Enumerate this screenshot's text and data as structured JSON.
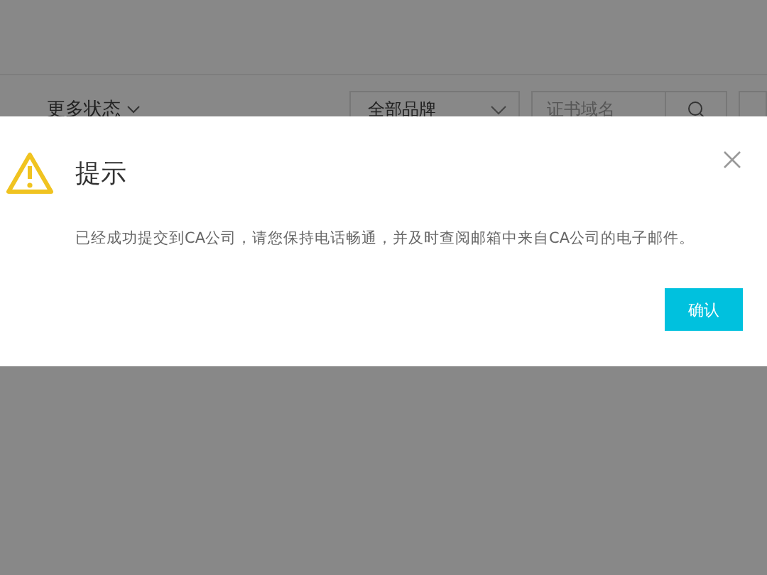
{
  "filter_bar": {
    "status_filter": "更多状态",
    "brand_select": {
      "value": "全部品牌"
    },
    "search": {
      "placeholder": "证书域名"
    }
  },
  "dialog": {
    "title": "提示",
    "message": "已经成功提交到CA公司，请您保持电话畅通，并及时查阅邮箱中来自CA公司的电子邮件。",
    "buttons": [
      "确认"
    ]
  }
}
